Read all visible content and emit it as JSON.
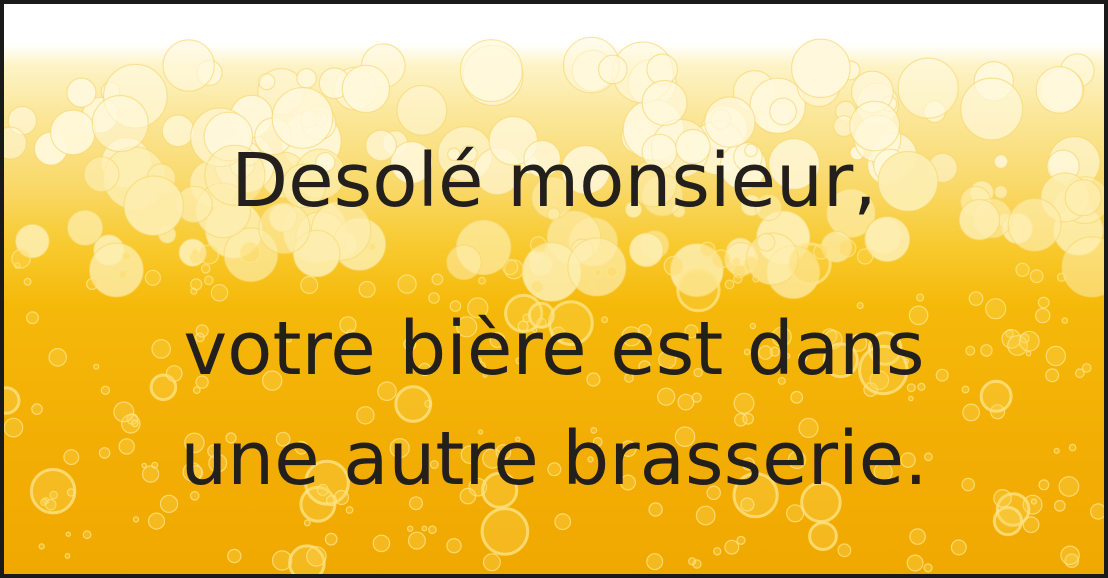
{
  "message": {
    "line1": "Desolé monsieur,",
    "line2": "votre bière est dans",
    "line3": "une autre brasserie."
  },
  "colors": {
    "beer": "#f5b90a",
    "foam": "#fdf3c6",
    "text": "#231f1c",
    "border": "#1a1a1a"
  }
}
